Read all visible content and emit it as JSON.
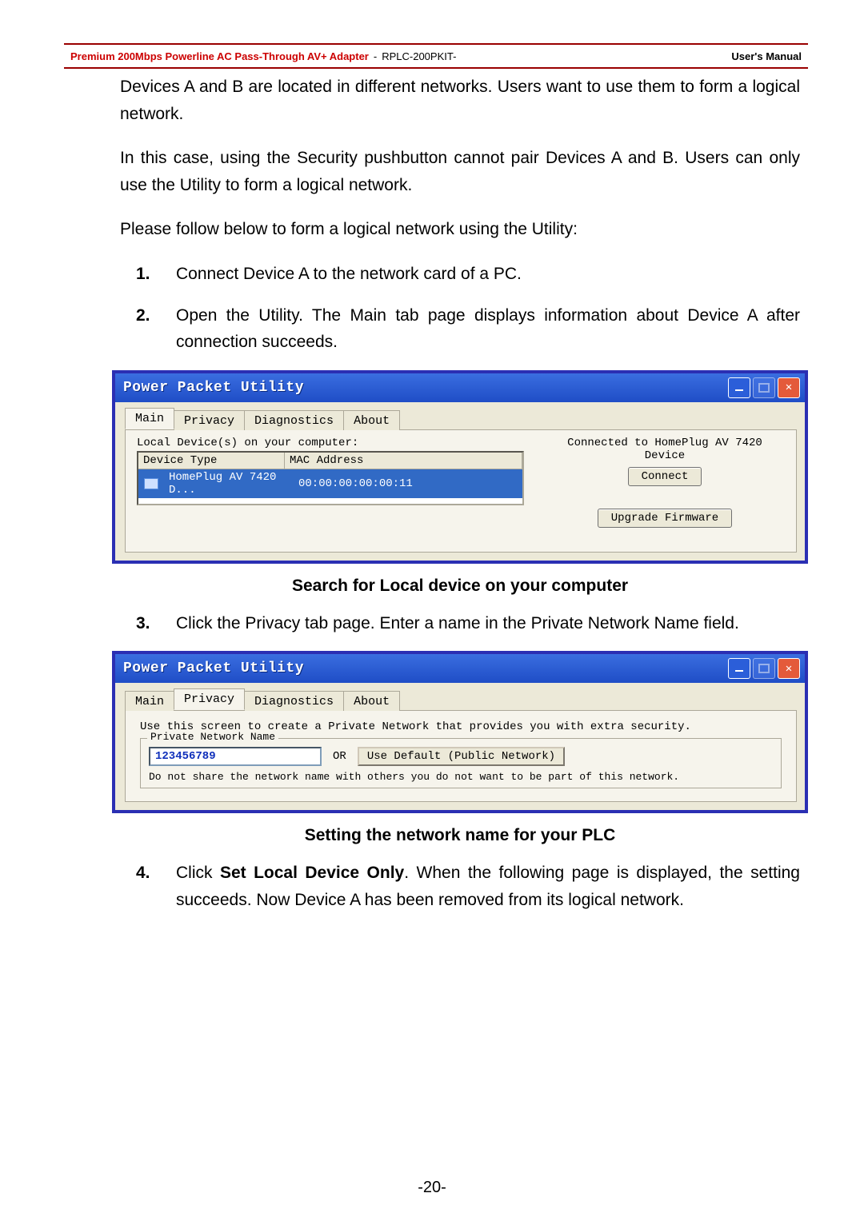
{
  "header": {
    "product": "Premium 200Mbps Powerline AC Pass-Through AV+ Adapter",
    "dash": " - ",
    "model": "RPLC-200PKIT-",
    "manual": "User's Manual"
  },
  "body": {
    "p1": "Devices A and B are located in different networks. Users want to use them to form a logical network.",
    "p2": "In this case, using the Security pushbutton cannot pair Devices A and B. Users can only use the Utility to form a logical network.",
    "p3": "Please follow below to form a logical network using the Utility:",
    "li1": "Connect Device A to the network card of a PC.",
    "li2": "Open the Utility. The Main tab page displays information about Device A after connection succeeds.",
    "caption1": "Search for Local device on your computer",
    "li3": "Click the Privacy tab page. Enter a name in the Private Network Name field.",
    "caption2": "Setting the network name for your PLC",
    "li4a": "Click ",
    "li4b": "Set Local Device Only",
    "li4c": ". When the following page is displayed, the setting succeeds. Now Device A has been removed from its logical network."
  },
  "shot1": {
    "title": "Power Packet Utility",
    "tabs": [
      "Main",
      "Privacy",
      "Diagnostics",
      "About"
    ],
    "active_tab": 0,
    "local_label": "Local Device(s) on your computer:",
    "col1": "Device Type",
    "col2": "MAC Address",
    "row_type": "HomePlug AV 7420 D...",
    "row_mac": "00:00:00:00:00:11",
    "status": "Connected to HomePlug AV 7420 Device",
    "connect_btn": "Connect",
    "upgrade_btn": "Upgrade Firmware"
  },
  "shot2": {
    "title": "Power Packet Utility",
    "tabs": [
      "Main",
      "Privacy",
      "Diagnostics",
      "About"
    ],
    "active_tab": 1,
    "instruction": "Use this screen to create a Private Network that provides you with extra security.",
    "group_legend": "Private Network Name",
    "value": "123456789",
    "or": "OR",
    "default_btn": "Use Default (Public Network)",
    "note": "Do not share the network name with others you do not want to be part of this network."
  },
  "page_number": "-20-"
}
